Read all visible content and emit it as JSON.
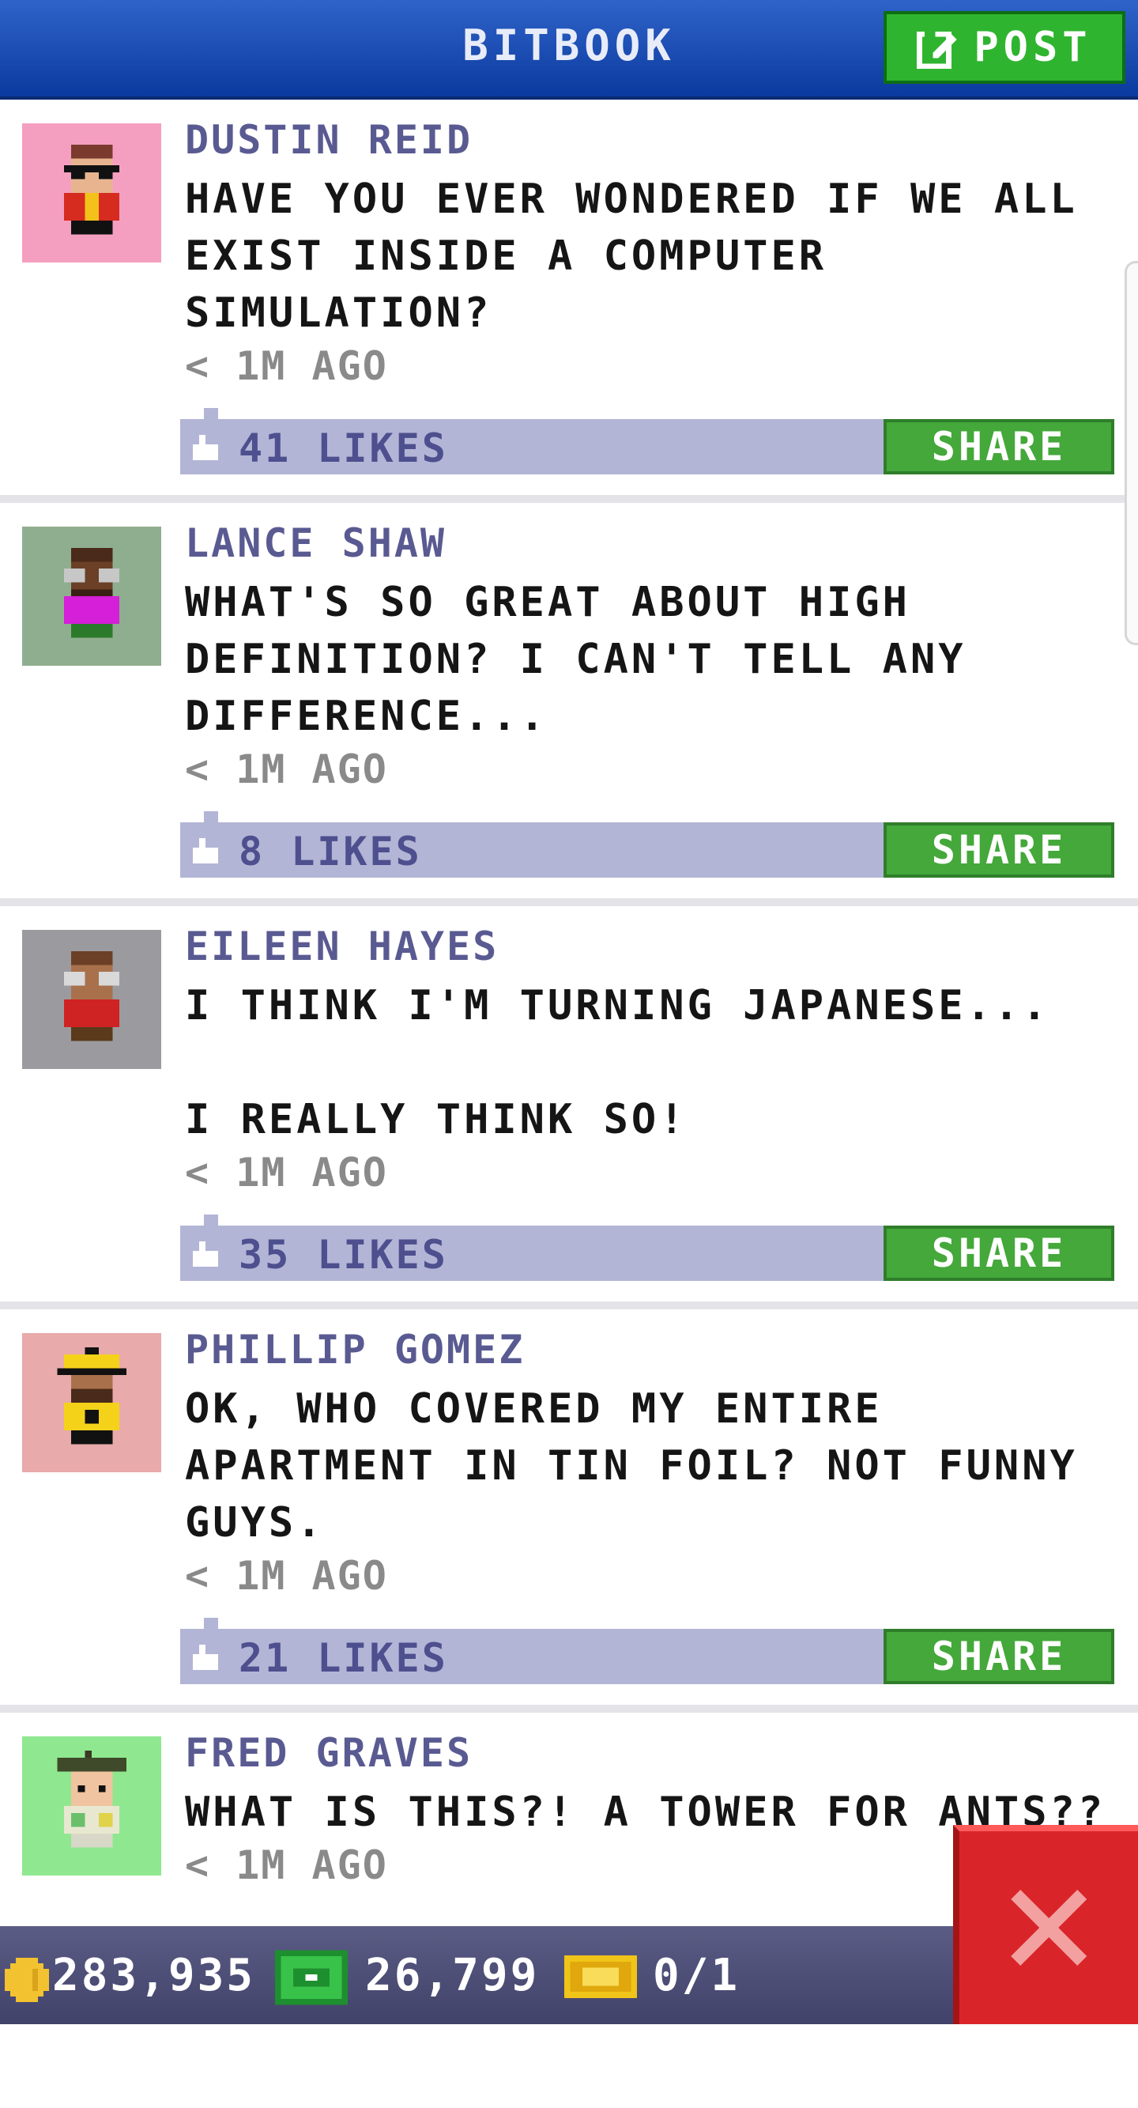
{
  "header": {
    "title": "BITBOOK",
    "post_label": "POST",
    "post_icon": "compose-icon"
  },
  "feed": {
    "share_label": "SHARE",
    "posts": [
      {
        "author": "DUSTIN REID",
        "message": "HAVE YOU EVER WONDERED IF WE ALL\nEXIST INSIDE A COMPUTER\nSIMULATION?",
        "time": "< 1M AGO",
        "likes": "41 LIKES",
        "avatar_bg": "#f59fc0",
        "avatar_icon": "pixel-person-sunglasses-avatar"
      },
      {
        "author": "LANCE SHAW",
        "message": "WHAT'S SO GREAT ABOUT HIGH\nDEFINITION? I CAN'T TELL ANY\nDIFFERENCE...",
        "time": "< 1M AGO",
        "likes": "8 LIKES",
        "avatar_bg": "#8fae8f",
        "avatar_icon": "pixel-person-glasses-avatar"
      },
      {
        "author": "EILEEN HAYES",
        "message": "I THINK I'M TURNING JAPANESE...\n\nI REALLY THINK SO!",
        "time": "< 1M AGO",
        "likes": "35 LIKES",
        "avatar_bg": "#9b9b9f",
        "avatar_icon": "pixel-person-glasses-avatar"
      },
      {
        "author": "PHILLIP GOMEZ",
        "message": "OK, WHO COVERED MY ENTIRE\nAPARTMENT IN TIN FOIL? NOT FUNNY\nGUYS.",
        "time": "< 1M AGO",
        "likes": "21 LIKES",
        "avatar_bg": "#e8aaaa",
        "avatar_icon": "pixel-person-hat-avatar"
      },
      {
        "author": "FRED GRAVES",
        "message": "WHAT IS THIS?! A TOWER FOR ANTS??",
        "time": "< 1M AGO",
        "likes": "",
        "avatar_bg": "#8fe88f",
        "avatar_icon": "pixel-person-beret-avatar"
      }
    ]
  },
  "status": {
    "coins": "283,935",
    "bux": "26,799",
    "tickets": "0/1",
    "coin_icon": "coin-icon",
    "bux_icon": "bux-icon",
    "ticket_icon": "ticket-icon"
  },
  "close_icon": "close-icon",
  "colors": {
    "header": "#1c4fb8",
    "post_button": "#2fb42f",
    "share_button": "#44a83a",
    "like_bar": "#b3b5d6",
    "close_button": "#d9252a"
  }
}
